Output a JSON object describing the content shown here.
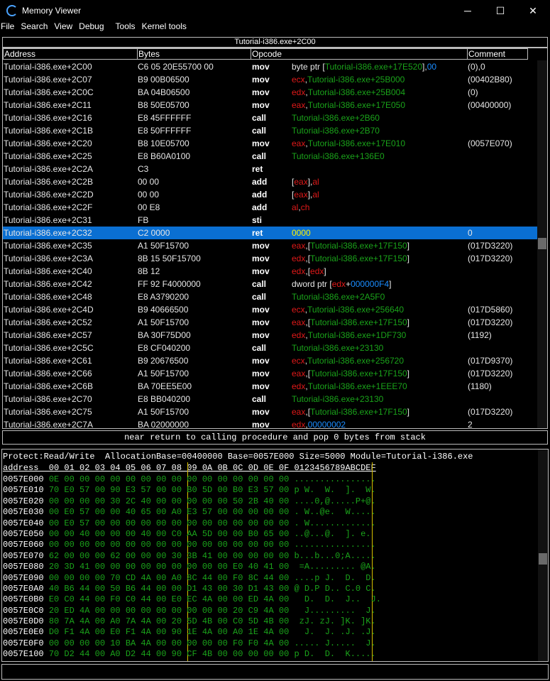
{
  "window": {
    "title": "Memory Viewer",
    "minimize": "─",
    "maximize": "☐",
    "close": "✕"
  },
  "menu": [
    "File",
    "Search",
    "View",
    "Debug",
    "Tools",
    "Kernel tools"
  ],
  "disasm": {
    "location": "Tutorial-i386.exe+2C00",
    "headers": {
      "address": "Address",
      "bytes": "Bytes",
      "opcode": "Opcode",
      "comment": "Comment"
    },
    "rows": [
      {
        "addr": "Tutorial-i386.exe+2C00",
        "bytes": "C6 05 20E55700 00",
        "op": "mov",
        "args": [
          {
            "t": "byte ptr [",
            "c": "plain"
          },
          {
            "t": "Tutorial-i386.exe+17E520",
            "c": "sym"
          },
          {
            "t": "],",
            "c": "plain"
          },
          {
            "t": "00",
            "c": "num"
          }
        ],
        "comment": "(0),0"
      },
      {
        "addr": "Tutorial-i386.exe+2C07",
        "bytes": "B9 00B06500",
        "op": "mov",
        "args": [
          {
            "t": "ecx",
            "c": "reg"
          },
          {
            "t": ",",
            "c": "plain"
          },
          {
            "t": "Tutorial-i386.exe+25B000",
            "c": "sym"
          }
        ],
        "comment": "(00402B80)"
      },
      {
        "addr": "Tutorial-i386.exe+2C0C",
        "bytes": "BA 04B06500",
        "op": "mov",
        "args": [
          {
            "t": "edx",
            "c": "reg"
          },
          {
            "t": ",",
            "c": "plain"
          },
          {
            "t": "Tutorial-i386.exe+25B004",
            "c": "sym"
          }
        ],
        "comment": "(0)"
      },
      {
        "addr": "Tutorial-i386.exe+2C11",
        "bytes": "B8 50E05700",
        "op": "mov",
        "args": [
          {
            "t": "eax",
            "c": "reg"
          },
          {
            "t": ",",
            "c": "plain"
          },
          {
            "t": "Tutorial-i386.exe+17E050",
            "c": "sym"
          }
        ],
        "comment": "(00400000)"
      },
      {
        "addr": "Tutorial-i386.exe+2C16",
        "bytes": "E8 45FFFFFF",
        "op": "call",
        "args": [
          {
            "t": "Tutorial-i386.exe+2B60",
            "c": "sym"
          }
        ],
        "comment": ""
      },
      {
        "addr": "Tutorial-i386.exe+2C1B",
        "bytes": "E8 50FFFFFF",
        "op": "call",
        "args": [
          {
            "t": "Tutorial-i386.exe+2B70",
            "c": "sym"
          }
        ],
        "comment": ""
      },
      {
        "addr": "Tutorial-i386.exe+2C20",
        "bytes": "B8 10E05700",
        "op": "mov",
        "args": [
          {
            "t": "eax",
            "c": "reg"
          },
          {
            "t": ",",
            "c": "plain"
          },
          {
            "t": "Tutorial-i386.exe+17E010",
            "c": "sym"
          }
        ],
        "comment": "(0057E070)"
      },
      {
        "addr": "Tutorial-i386.exe+2C25",
        "bytes": "E8 B60A0100",
        "op": "call",
        "args": [
          {
            "t": "Tutorial-i386.exe+136E0",
            "c": "sym"
          }
        ],
        "comment": ""
      },
      {
        "addr": "Tutorial-i386.exe+2C2A",
        "bytes": "C3",
        "op": "ret",
        "args": [],
        "comment": ""
      },
      {
        "addr": "Tutorial-i386.exe+2C2B",
        "bytes": "00 00",
        "op": "add",
        "args": [
          {
            "t": "[",
            "c": "plain"
          },
          {
            "t": "eax",
            "c": "reg"
          },
          {
            "t": "],",
            "c": "plain"
          },
          {
            "t": "al",
            "c": "reg"
          }
        ],
        "comment": ""
      },
      {
        "addr": "Tutorial-i386.exe+2C2D",
        "bytes": "00 00",
        "op": "add",
        "args": [
          {
            "t": "[",
            "c": "plain"
          },
          {
            "t": "eax",
            "c": "reg"
          },
          {
            "t": "],",
            "c": "plain"
          },
          {
            "t": "al",
            "c": "reg"
          }
        ],
        "comment": ""
      },
      {
        "addr": "Tutorial-i386.exe+2C2F",
        "bytes": "00 E8",
        "op": "add",
        "args": [
          {
            "t": "al",
            "c": "reg"
          },
          {
            "t": ",",
            "c": "plain"
          },
          {
            "t": "ch",
            "c": "reg"
          }
        ],
        "comment": ""
      },
      {
        "addr": "Tutorial-i386.exe+2C31",
        "bytes": "FB",
        "op": "sti",
        "args": [],
        "comment": ""
      },
      {
        "addr": "Tutorial-i386.exe+2C32",
        "bytes": "C2 0000",
        "op": "ret",
        "args": [
          {
            "t": "0000",
            "c": "sym"
          }
        ],
        "comment": "0",
        "selected": true
      },
      {
        "addr": "Tutorial-i386.exe+2C35",
        "bytes": "A1 50F15700",
        "op": "mov",
        "args": [
          {
            "t": "eax",
            "c": "reg"
          },
          {
            "t": ",[",
            "c": "plain"
          },
          {
            "t": "Tutorial-i386.exe+17F150",
            "c": "sym"
          },
          {
            "t": "]",
            "c": "plain"
          }
        ],
        "comment": "(017D3220)"
      },
      {
        "addr": "Tutorial-i386.exe+2C3A",
        "bytes": "8B 15 50F15700",
        "op": "mov",
        "args": [
          {
            "t": "edx",
            "c": "reg"
          },
          {
            "t": ",[",
            "c": "plain"
          },
          {
            "t": "Tutorial-i386.exe+17F150",
            "c": "sym"
          },
          {
            "t": "]",
            "c": "plain"
          }
        ],
        "comment": "(017D3220)"
      },
      {
        "addr": "Tutorial-i386.exe+2C40",
        "bytes": "8B 12",
        "op": "mov",
        "args": [
          {
            "t": "edx",
            "c": "reg"
          },
          {
            "t": ",[",
            "c": "plain"
          },
          {
            "t": "edx",
            "c": "reg"
          },
          {
            "t": "]",
            "c": "plain"
          }
        ],
        "comment": ""
      },
      {
        "addr": "Tutorial-i386.exe+2C42",
        "bytes": "FF 92 F4000000",
        "op": "call",
        "args": [
          {
            "t": "dword ptr [",
            "c": "plain"
          },
          {
            "t": "edx",
            "c": "reg"
          },
          {
            "t": "+",
            "c": "plain"
          },
          {
            "t": "000000F4",
            "c": "num"
          },
          {
            "t": "]",
            "c": "plain"
          }
        ],
        "comment": ""
      },
      {
        "addr": "Tutorial-i386.exe+2C48",
        "bytes": "E8 A3790200",
        "op": "call",
        "args": [
          {
            "t": "Tutorial-i386.exe+2A5F0",
            "c": "sym"
          }
        ],
        "comment": ""
      },
      {
        "addr": "Tutorial-i386.exe+2C4D",
        "bytes": "B9 40666500",
        "op": "mov",
        "args": [
          {
            "t": "ecx",
            "c": "reg"
          },
          {
            "t": ",",
            "c": "plain"
          },
          {
            "t": "Tutorial-i386.exe+256640",
            "c": "sym"
          }
        ],
        "comment": "(017D5860)"
      },
      {
        "addr": "Tutorial-i386.exe+2C52",
        "bytes": "A1 50F15700",
        "op": "mov",
        "args": [
          {
            "t": "eax",
            "c": "reg"
          },
          {
            "t": ",[",
            "c": "plain"
          },
          {
            "t": "Tutorial-i386.exe+17F150",
            "c": "sym"
          },
          {
            "t": "]",
            "c": "plain"
          }
        ],
        "comment": "(017D3220)"
      },
      {
        "addr": "Tutorial-i386.exe+2C57",
        "bytes": "BA 30F75D00",
        "op": "mov",
        "args": [
          {
            "t": "edx",
            "c": "reg"
          },
          {
            "t": ",",
            "c": "plain"
          },
          {
            "t": "Tutorial-i386.exe+1DF730",
            "c": "sym"
          }
        ],
        "comment": "(1192)"
      },
      {
        "addr": "Tutorial-i386.exe+2C5C",
        "bytes": "E8 CF040200",
        "op": "call",
        "args": [
          {
            "t": "Tutorial-i386.exe+23130",
            "c": "sym"
          }
        ],
        "comment": ""
      },
      {
        "addr": "Tutorial-i386.exe+2C61",
        "bytes": "B9 20676500",
        "op": "mov",
        "args": [
          {
            "t": "ecx",
            "c": "reg"
          },
          {
            "t": ",",
            "c": "plain"
          },
          {
            "t": "Tutorial-i386.exe+256720",
            "c": "sym"
          }
        ],
        "comment": "(017D9370)"
      },
      {
        "addr": "Tutorial-i386.exe+2C66",
        "bytes": "A1 50F15700",
        "op": "mov",
        "args": [
          {
            "t": "eax",
            "c": "reg"
          },
          {
            "t": ",[",
            "c": "plain"
          },
          {
            "t": "Tutorial-i386.exe+17F150",
            "c": "sym"
          },
          {
            "t": "]",
            "c": "plain"
          }
        ],
        "comment": "(017D3220)"
      },
      {
        "addr": "Tutorial-i386.exe+2C6B",
        "bytes": "BA 70EE5E00",
        "op": "mov",
        "args": [
          {
            "t": "edx",
            "c": "reg"
          },
          {
            "t": ",",
            "c": "plain"
          },
          {
            "t": "Tutorial-i386.exe+1EEE70",
            "c": "sym"
          }
        ],
        "comment": "(1180)"
      },
      {
        "addr": "Tutorial-i386.exe+2C70",
        "bytes": "E8 BB040200",
        "op": "call",
        "args": [
          {
            "t": "Tutorial-i386.exe+23130",
            "c": "sym"
          }
        ],
        "comment": ""
      },
      {
        "addr": "Tutorial-i386.exe+2C75",
        "bytes": "A1 50F15700",
        "op": "mov",
        "args": [
          {
            "t": "eax",
            "c": "reg"
          },
          {
            "t": ",[",
            "c": "plain"
          },
          {
            "t": "Tutorial-i386.exe+17F150",
            "c": "sym"
          },
          {
            "t": "]",
            "c": "plain"
          }
        ],
        "comment": "(017D3220)"
      },
      {
        "addr": "Tutorial-i386.exe+2C7A",
        "bytes": "BA 02000000",
        "op": "mov",
        "args": [
          {
            "t": "edx",
            "c": "reg"
          },
          {
            "t": ",",
            "c": "plain"
          },
          {
            "t": "00000002",
            "c": "num"
          }
        ],
        "comment": "2"
      }
    ]
  },
  "status": "near return to calling procedure and pop 0 bytes from stack",
  "hex": {
    "info": "Protect:Read/Write  AllocationBase=00400000 Base=0057E000 Size=5000 Module=Tutorial-i386.exe",
    "header": "address  00 01 02 03 04 05 06 07 08 09 0A 0B 0C 0D 0E 0F 0123456789ABCDEF",
    "rows": [
      {
        "addr": "0057E000",
        "bytes": "0E 00 00 00 00 00 00 00 00 00 00 00 00 00 00 00",
        "ascii": "................"
      },
      {
        "addr": "0057E010",
        "bytes": "70 E0 57 00 90 E3 57 00 00 B0 5D 00 B0 E3 57 00",
        "ascii": "p W.  W.  ].  W."
      },
      {
        "addr": "0057E020",
        "bytes": "00 00 00 00 30 2C 40 00 00 00 00 00 50 2B 40 00",
        "ascii": "....0,@.....P+@."
      },
      {
        "addr": "0057E030",
        "bytes": "00 E0 57 00 00 40 65 00 A0 E3 57 00 00 00 00 00",
        "ascii": ". W..@e.  W....."
      },
      {
        "addr": "0057E040",
        "bytes": "00 E0 57 00 00 00 00 00 00 00 00 00 00 00 00 00",
        "ascii": ". W............."
      },
      {
        "addr": "0057E050",
        "bytes": "00 00 40 00 00 00 40 00 C0 AA 5D 00 00 B0 65 00",
        "ascii": "..@...@.  ]. e."
      },
      {
        "addr": "0057E060",
        "bytes": "00 00 00 00 00 00 00 00 00 00 00 00 00 00 00 00",
        "ascii": "................"
      },
      {
        "addr": "0057E070",
        "bytes": "62 00 00 00 62 00 00 00 30 3B 41 00 00 00 00 00",
        "ascii": "b...b...0;A....."
      },
      {
        "addr": "0057E080",
        "bytes": "20 3D 41 00 00 00 00 00 00 00 00 00 E0 40 41 00",
        "ascii": " =A......... @A."
      },
      {
        "addr": "0057E090",
        "bottom": false,
        "bytes": "00 00 00 00 70 CD 4A 00 A0 8C 44 00 F0 8C 44 00",
        "ascii": "....p J.  D.  D."
      },
      {
        "addr": "0057E0A0",
        "bytes": "40 B6 44 00 50 B6 44 00 00 D1 43 00 30 D1 43 00",
        "ascii": "@ D.P D.. C.0 C."
      },
      {
        "addr": "0057E0B0",
        "bytes": "E0 C0 44 00 F0 C0 44 00 E0 EC 4A 00 00 ED 4A 00",
        "ascii": "  D.  D.  J..  J."
      },
      {
        "addr": "0057E0C0",
        "bytes": "20 ED 4A 00 00 00 00 00 00 00 00 00 20 C9 4A 00",
        "ascii": "  J.........  J."
      },
      {
        "addr": "0057E0D0",
        "bytes": "80 7A 4A 00 A0 7A 4A 00 20 5D 4B 00 C0 5D 4B 00",
        "ascii": " zJ. zJ. ]K. ]K."
      },
      {
        "addr": "0057E0E0",
        "bytes": "D0 F1 4A 00 E0 F1 4A 00 90 1E 4A 00 A0 1E 4A 00",
        "ascii": "  J.  J. .J. .J."
      },
      {
        "addr": "0057E0F0",
        "bytes": "00 00 00 00 10 BA 4A 00 00 00 00 00 F0 F0 4A 00",
        "ascii": "..... J.....  J."
      },
      {
        "addr": "0057E100",
        "bytes": "70 D2 44 00 A0 D2 44 00 90 CF 4B 00 00 00 00 00",
        "ascii": "p D.  D.  K....."
      }
    ]
  }
}
